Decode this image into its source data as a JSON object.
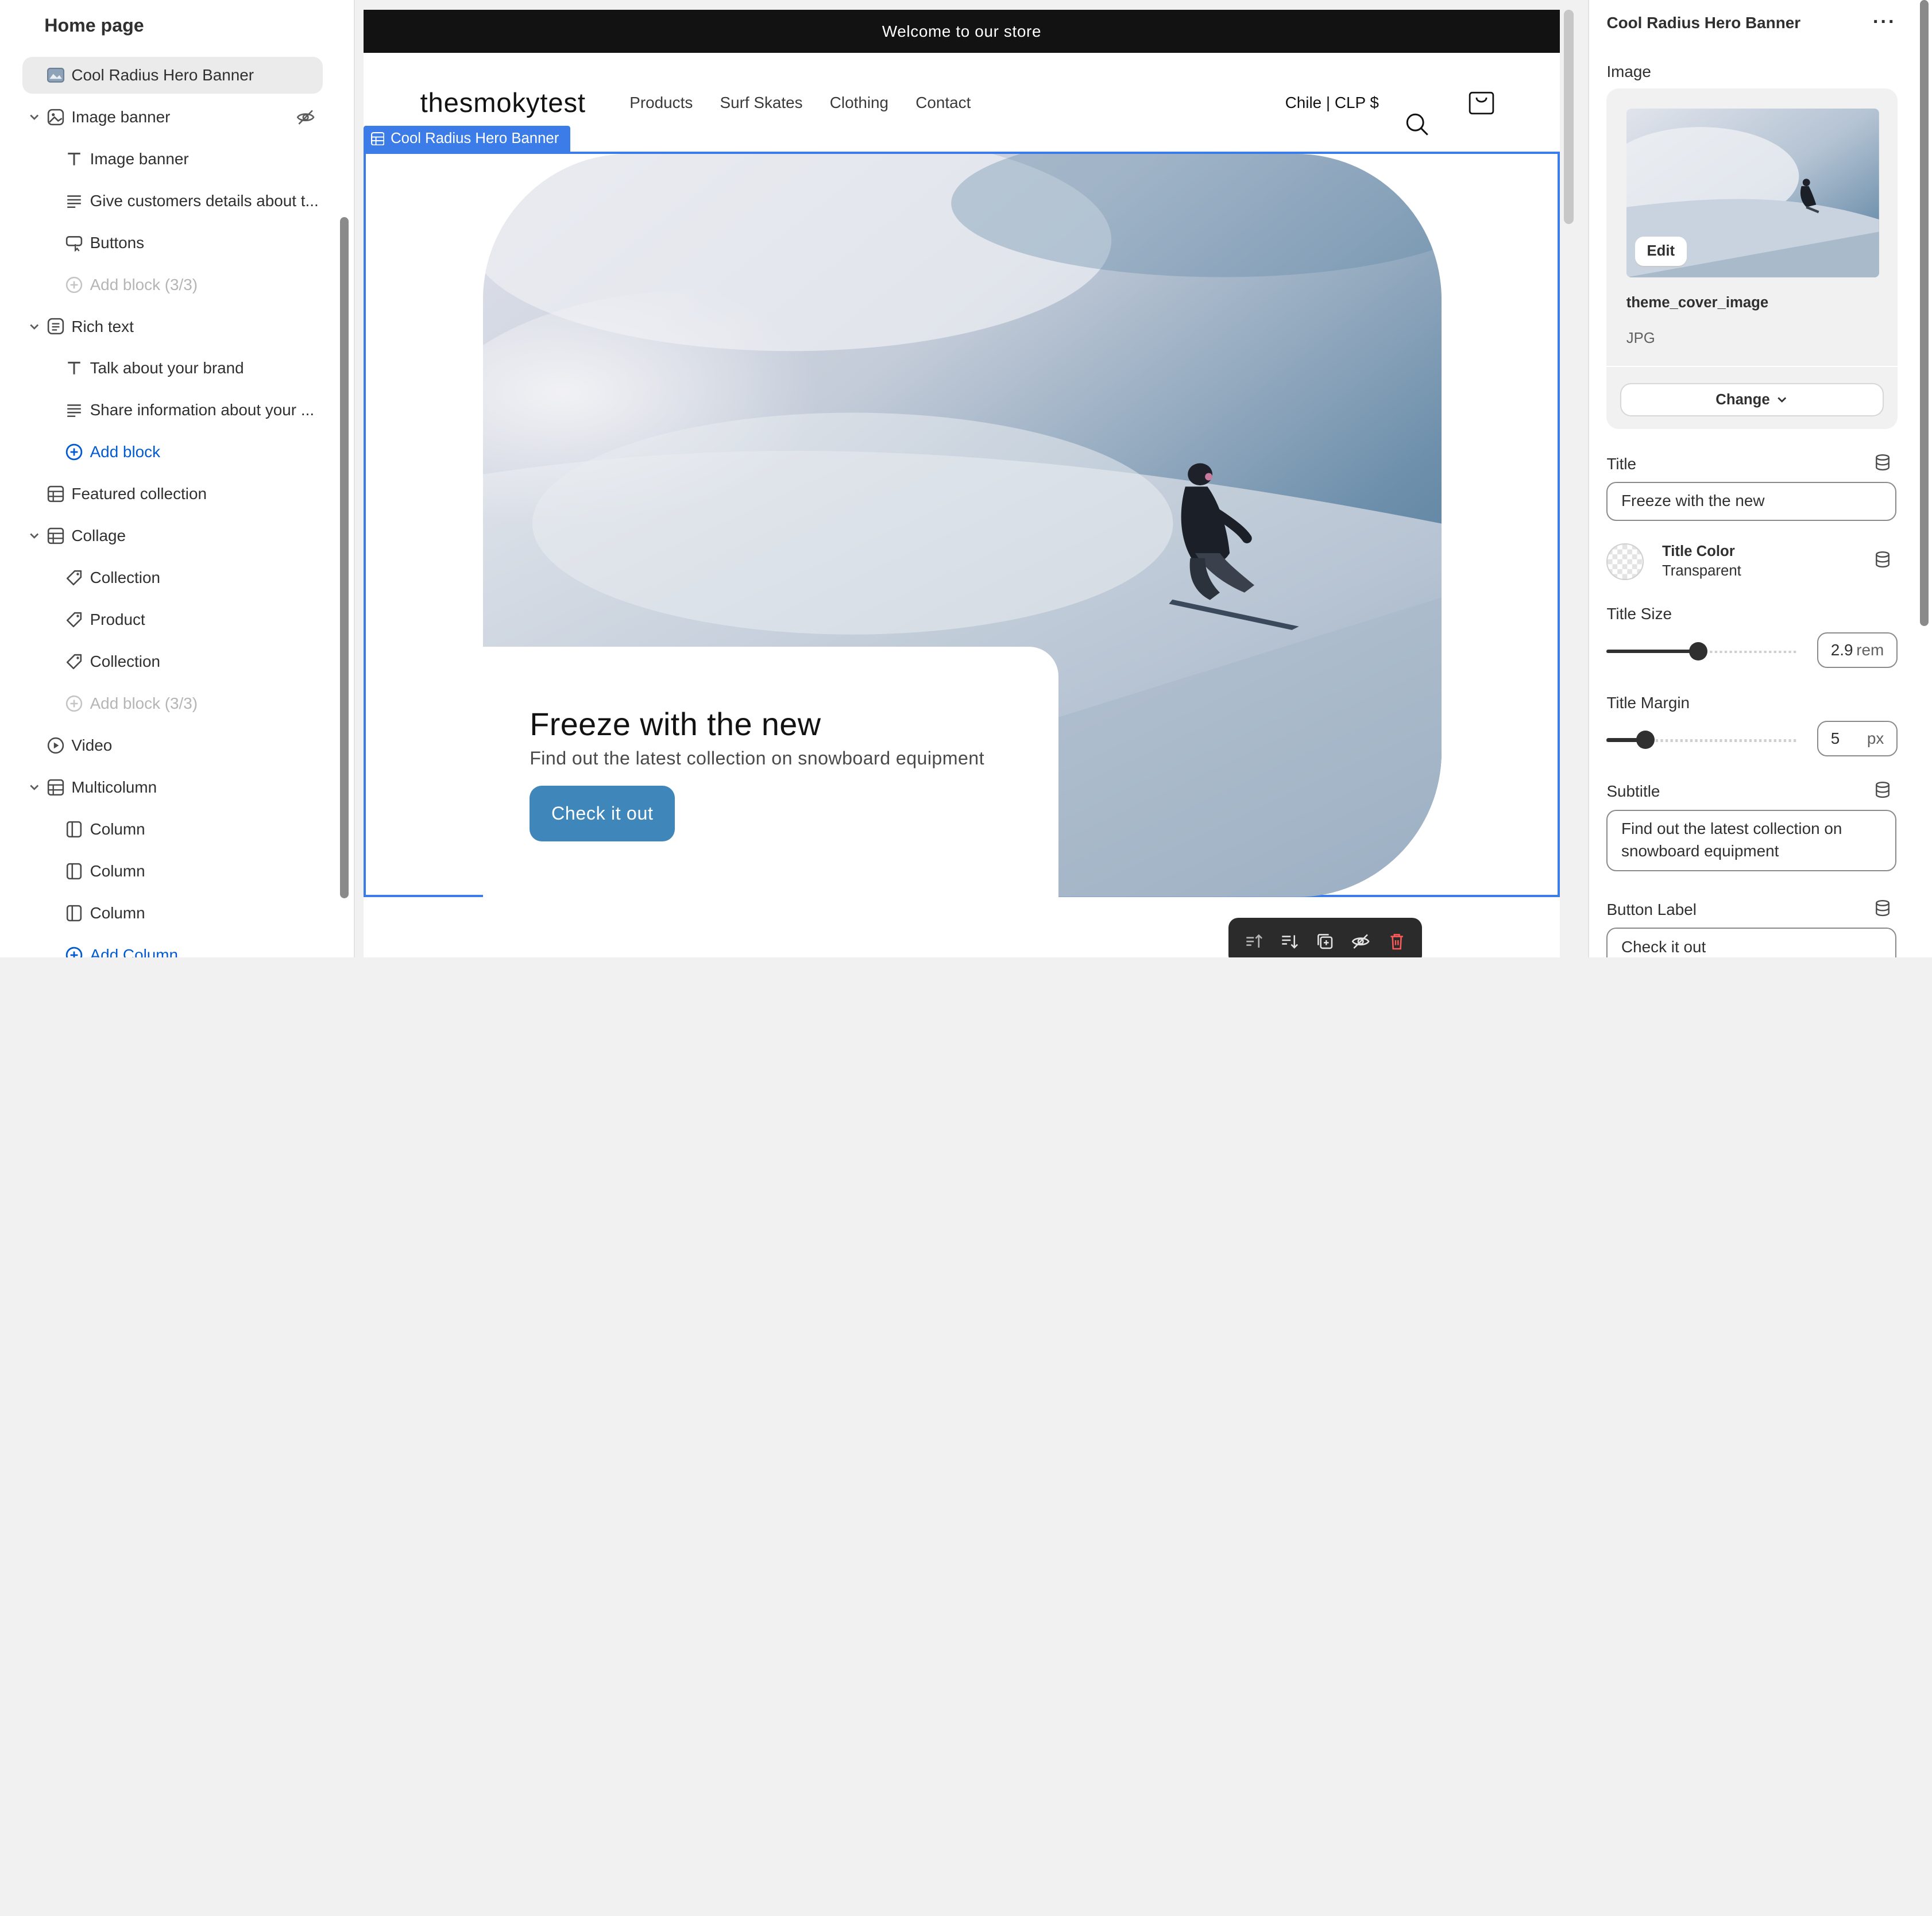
{
  "sidebar": {
    "title": "Home page",
    "items": [
      {
        "label": "Cool Radius Hero Banner",
        "icon": "section-image-icon"
      },
      {
        "label": "Image banner",
        "icon": "image-icon"
      },
      {
        "label": "Image banner",
        "icon": "text-type-icon"
      },
      {
        "label": "Give customers details about t...",
        "icon": "text-lines-icon"
      },
      {
        "label": "Buttons",
        "icon": "button-icon"
      },
      {
        "label": "Add block (3/3)",
        "icon": "add-circle-icon"
      },
      {
        "label": "Rich text",
        "icon": "rich-text-icon"
      },
      {
        "label": "Talk about your brand",
        "icon": "text-type-icon"
      },
      {
        "label": "Share information about your ...",
        "icon": "text-lines-icon"
      },
      {
        "label": "Add block",
        "icon": "add-circle-icon"
      },
      {
        "label": "Featured collection",
        "icon": "collection-grid-icon"
      },
      {
        "label": "Collage",
        "icon": "collection-grid-icon"
      },
      {
        "label": "Collection",
        "icon": "tag-icon"
      },
      {
        "label": "Product",
        "icon": "tag-icon"
      },
      {
        "label": "Collection",
        "icon": "tag-icon"
      },
      {
        "label": "Add block (3/3)",
        "icon": "add-circle-icon"
      },
      {
        "label": "Video",
        "icon": "play-icon"
      },
      {
        "label": "Multicolumn",
        "icon": "collection-grid-icon"
      },
      {
        "label": "Column",
        "icon": "column-icon"
      },
      {
        "label": "Column",
        "icon": "column-icon"
      },
      {
        "label": "Column",
        "icon": "column-icon"
      },
      {
        "label": "Add Column",
        "icon": "add-circle-icon"
      }
    ]
  },
  "preview": {
    "announcement": "Welcome to our store",
    "brand": "thesmokytest",
    "nav": [
      "Products",
      "Surf Skates",
      "Clothing",
      "Contact"
    ],
    "currency": "Chile | CLP $",
    "section_tag": "Cool Radius Hero Banner",
    "hero": {
      "title": "Freeze with the new",
      "subtitle": "Find out the latest collection on snowboard equipment",
      "button": "Check it out"
    }
  },
  "panel": {
    "title": "Cool Radius Hero Banner",
    "image_label": "Image",
    "edit_label": "Edit",
    "image_name": "theme_cover_image",
    "image_type": "JPG",
    "change_label": "Change",
    "title_label": "Title",
    "title_value": "Freeze with the new",
    "title_color_label": "Title Color",
    "title_color_value": "Transparent",
    "title_size_label": "Title Size",
    "title_size_value": "2.9",
    "title_size_unit": "rem",
    "title_size_fraction": 0.48,
    "title_margin_label": "Title Margin",
    "title_margin_value": "5",
    "title_margin_unit": "px",
    "title_margin_fraction": 0.2,
    "subtitle_label": "Subtitle",
    "subtitle_value": "Find out the latest collection on snowboard equipment",
    "button_label_label": "Button Label",
    "button_label_value": "Check it out"
  },
  "colors": {
    "accent": "#3b7ce8",
    "hero_button": "#3f86bb",
    "link_blue": "#005bd3",
    "announcement_bg": "#121212"
  }
}
